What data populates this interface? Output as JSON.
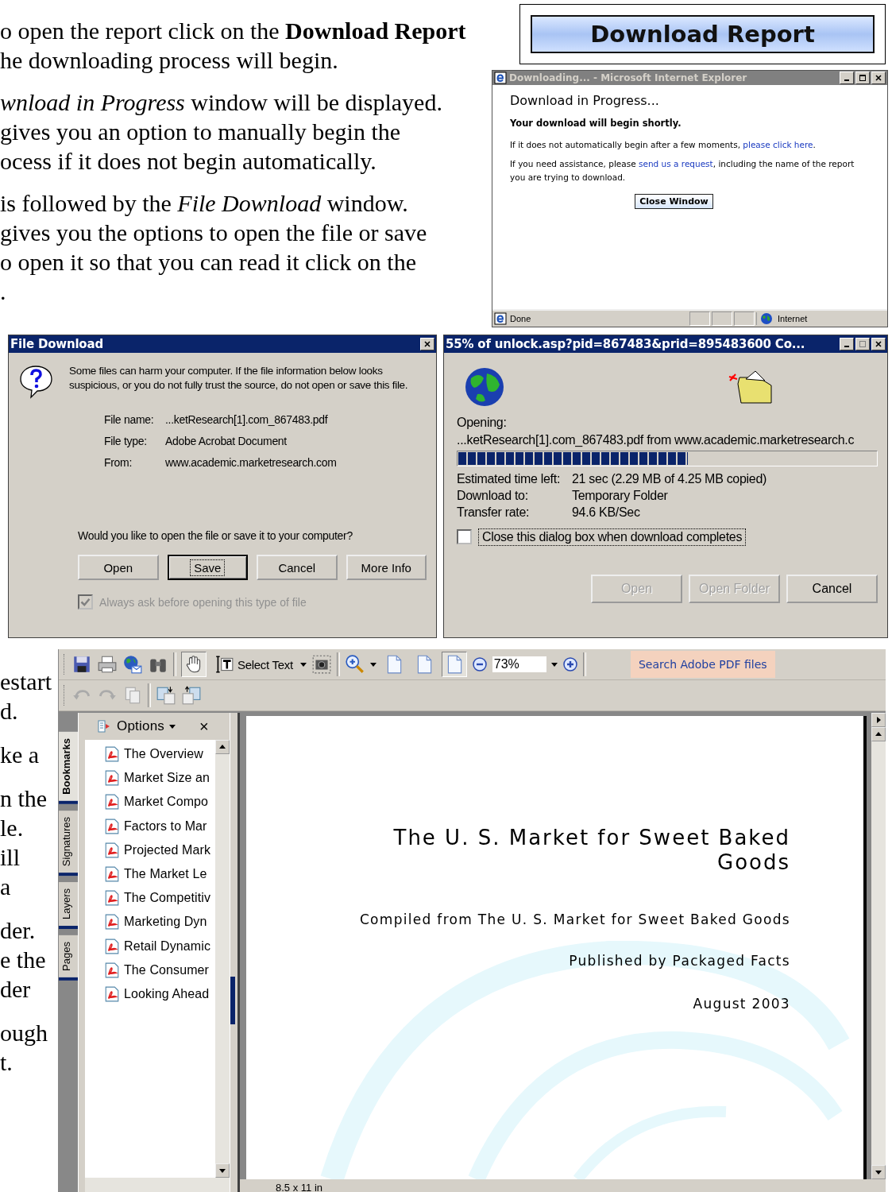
{
  "intro_text": [
    [
      "o open the report click on the **Download Report**",
      "he downloading process will begin."
    ],
    [
      "*wnload in Progress* window will be displayed.",
      "gives you an option to manually begin the",
      "ocess if it does not begin automatically."
    ],
    [
      "is followed by the *File Download* window.",
      "gives you the options to open the file or save",
      "o open it so that you can read it click on the",
      "."
    ]
  ],
  "download_report_button": {
    "label": "Download Report"
  },
  "ie_window": {
    "title": "Downloading... - Microsoft Internet Explorer",
    "heading": "Download in Progress...",
    "lead": "Your download will begin shortly.",
    "paragraphs": [
      {
        "before": "If it does not automatically begin after a few moments, ",
        "link": "please click here",
        "after": "."
      },
      {
        "before": "If you need assistance, please ",
        "link": "send us a request",
        "after": ", including the name of the report you are trying to download."
      }
    ],
    "button": "Close Window",
    "status": "Done",
    "zone": "Internet"
  },
  "file_download": {
    "title": "File Download",
    "message": "Some files can harm your computer. If the file information below looks suspicious, or you do not fully trust the source, do not open or save this file.",
    "fields": [
      {
        "label": "File name:",
        "value": "...ketResearch[1].com_867483.pdf"
      },
      {
        "label": "File type:",
        "value": "Adobe Acrobat Document"
      },
      {
        "label": "From:",
        "value": "www.academic.marketresearch.com"
      }
    ],
    "question": "Would you like to open the file or save it to your computer?",
    "buttons": [
      {
        "label": "Open",
        "default": false
      },
      {
        "label": "Save",
        "default": true
      },
      {
        "label": "Cancel",
        "default": false
      },
      {
        "label": "More Info",
        "default": false
      }
    ],
    "checkbox": {
      "label": "Always ask before opening this type of file",
      "checked": true,
      "disabled": true
    }
  },
  "progress_dialog": {
    "title": "55% of unlock.asp?pid=867483&prid=895483600 Co...",
    "opening_label": "Opening:",
    "source": "...ketResearch[1].com_867483.pdf from www.academic.marketresearch.c",
    "progress": {
      "level": 0.55
    },
    "details": [
      {
        "label": "Estimated time left:",
        "value": "21 sec (2.29 MB of 4.25 MB copied)"
      },
      {
        "label": "Download to:",
        "value": "Temporary Folder"
      },
      {
        "label": "Transfer rate:",
        "value": "94.6 KB/Sec"
      }
    ],
    "checkbox": {
      "label": "Close this dialog box when download completes",
      "checked": false
    },
    "buttons": [
      {
        "label": "Open",
        "disabled": true
      },
      {
        "label": "Open Folder",
        "disabled": true
      },
      {
        "label": "Cancel",
        "disabled": false
      }
    ]
  },
  "side_text": [
    [
      "estart",
      "d."
    ],
    [
      "ke a"
    ],
    [
      "n the",
      "le.",
      "ill",
      "a"
    ],
    [
      "der.",
      "e the",
      "der"
    ],
    [
      "ough",
      "t."
    ]
  ],
  "acrobat": {
    "hand_tool_selected": true,
    "select_tool_label": "Select Text",
    "page_views": [
      {
        "selected": false
      },
      {
        "selected": false
      },
      {
        "selected": true
      }
    ],
    "zoom": "73%",
    "search_button": "Search Adobe PDF files",
    "side_tabs": [
      {
        "label": "Bookmarks",
        "selected": true
      },
      {
        "label": "Signatures",
        "selected": false
      },
      {
        "label": "Layers",
        "selected": false
      },
      {
        "label": "Pages",
        "selected": false
      }
    ],
    "panel": {
      "options": "Options",
      "close": "×"
    },
    "bookmarks": [
      "The Overview",
      "Market Size an",
      "Market Compo",
      "Factors to Mar",
      "Projected Mark",
      "The Market Le",
      "The Competitiv",
      "Marketing Dyn",
      "Retail Dynamic",
      "The Consumer",
      "Looking Ahead"
    ],
    "document": {
      "title": "The U. S. Market for Sweet Baked Goods",
      "subtitle": "Compiled from The U. S. Market for Sweet Baked Goods",
      "publisher": "Published by Packaged Facts",
      "date": "August 2003"
    },
    "page_size": "8.5 x 11 in"
  }
}
